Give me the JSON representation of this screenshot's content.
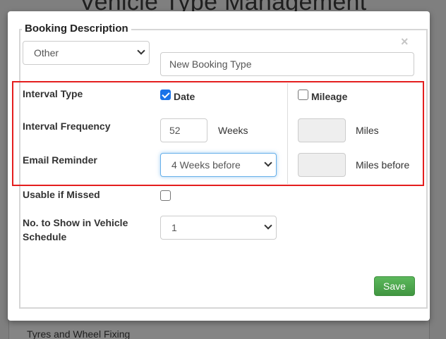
{
  "background": {
    "page_title": "Vehicle Type Management",
    "list_item": "Tyres and Wheel Fixing"
  },
  "modal": {
    "legend": "Booking Description",
    "close_glyph": "×",
    "category_select": {
      "value": "Other"
    },
    "booking_type_input": {
      "placeholder": "New Booking Type"
    },
    "interval_type_label": "Interval Type",
    "date_checkbox": {
      "label": "Date",
      "checked": true
    },
    "mileage_checkbox": {
      "label": "Mileage",
      "checked": false
    },
    "interval_frequency_label": "Interval Frequency",
    "frequency_value": "52",
    "frequency_unit": "Weeks",
    "miles_unit": "Miles",
    "email_reminder_label": "Email Reminder",
    "email_reminder_select": {
      "value": "4 Weeks before"
    },
    "miles_before_unit": "Miles before",
    "usable_if_missed_label": "Usable if Missed",
    "usable_if_missed_checked": false,
    "show_in_schedule_label_line1": "No. to Show in Vehicle",
    "show_in_schedule_label_line2": "Schedule",
    "show_in_schedule_select": {
      "value": "1"
    },
    "save_label": "Save"
  },
  "colors": {
    "highlight_border": "#e41e1e",
    "save_button": "#4cae4c",
    "checkbox_checked": "#1a73e8"
  }
}
